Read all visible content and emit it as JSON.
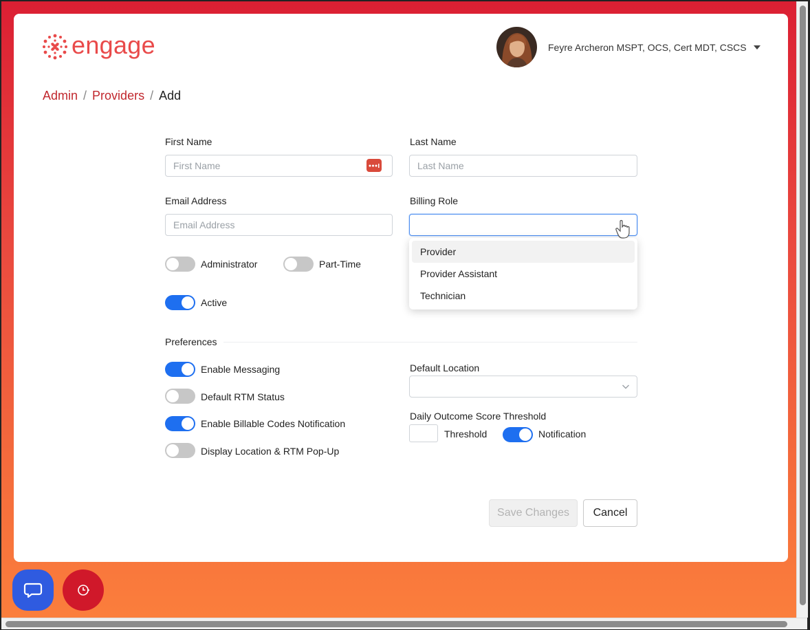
{
  "app": {
    "logo_text": "engage",
    "brand_color": "#e94a4a",
    "accent_color": "#1e6ff0"
  },
  "user": {
    "name": "Feyre Archeron MSPT, OCS, Cert MDT, CSCS"
  },
  "breadcrumb": {
    "items": [
      "Admin",
      "Providers",
      "Add"
    ],
    "separator": "/"
  },
  "form": {
    "first_name": {
      "label": "First Name",
      "placeholder": "First Name",
      "value": ""
    },
    "last_name": {
      "label": "Last Name",
      "placeholder": "Last Name",
      "value": ""
    },
    "email": {
      "label": "Email Address",
      "placeholder": "Email Address",
      "value": ""
    },
    "billing_role": {
      "label": "Billing Role",
      "value": "",
      "options": [
        "Provider",
        "Provider Assistant",
        "Technician"
      ],
      "highlighted": "Provider"
    },
    "toggles": {
      "administrator": {
        "label": "Administrator",
        "on": false
      },
      "part_time": {
        "label": "Part-Time",
        "on": false
      },
      "active": {
        "label": "Active",
        "on": true
      }
    }
  },
  "preferences": {
    "title": "Preferences",
    "enable_messaging": {
      "label": "Enable Messaging",
      "on": true
    },
    "default_rtm_status": {
      "label": "Default RTM Status",
      "on": false
    },
    "enable_billable_codes": {
      "label": "Enable Billable Codes Notification",
      "on": true
    },
    "display_location_popup": {
      "label": "Display Location & RTM Pop-Up",
      "on": false
    },
    "default_location": {
      "label": "Default Location",
      "value": ""
    },
    "daily_outcome": {
      "label": "Daily Outcome Score Threshold",
      "threshold_label": "Threshold",
      "threshold_value": "",
      "notification_label": "Notification",
      "notification_on": true
    }
  },
  "actions": {
    "save_label": "Save Changes",
    "cancel_label": "Cancel"
  },
  "icons": {
    "chat": "chat-bubble-icon",
    "timer": "timer-icon",
    "password_manager": "password-manager-icon",
    "user_caret": "caret-down-icon",
    "select_chevron": "chevron-down-icon"
  }
}
